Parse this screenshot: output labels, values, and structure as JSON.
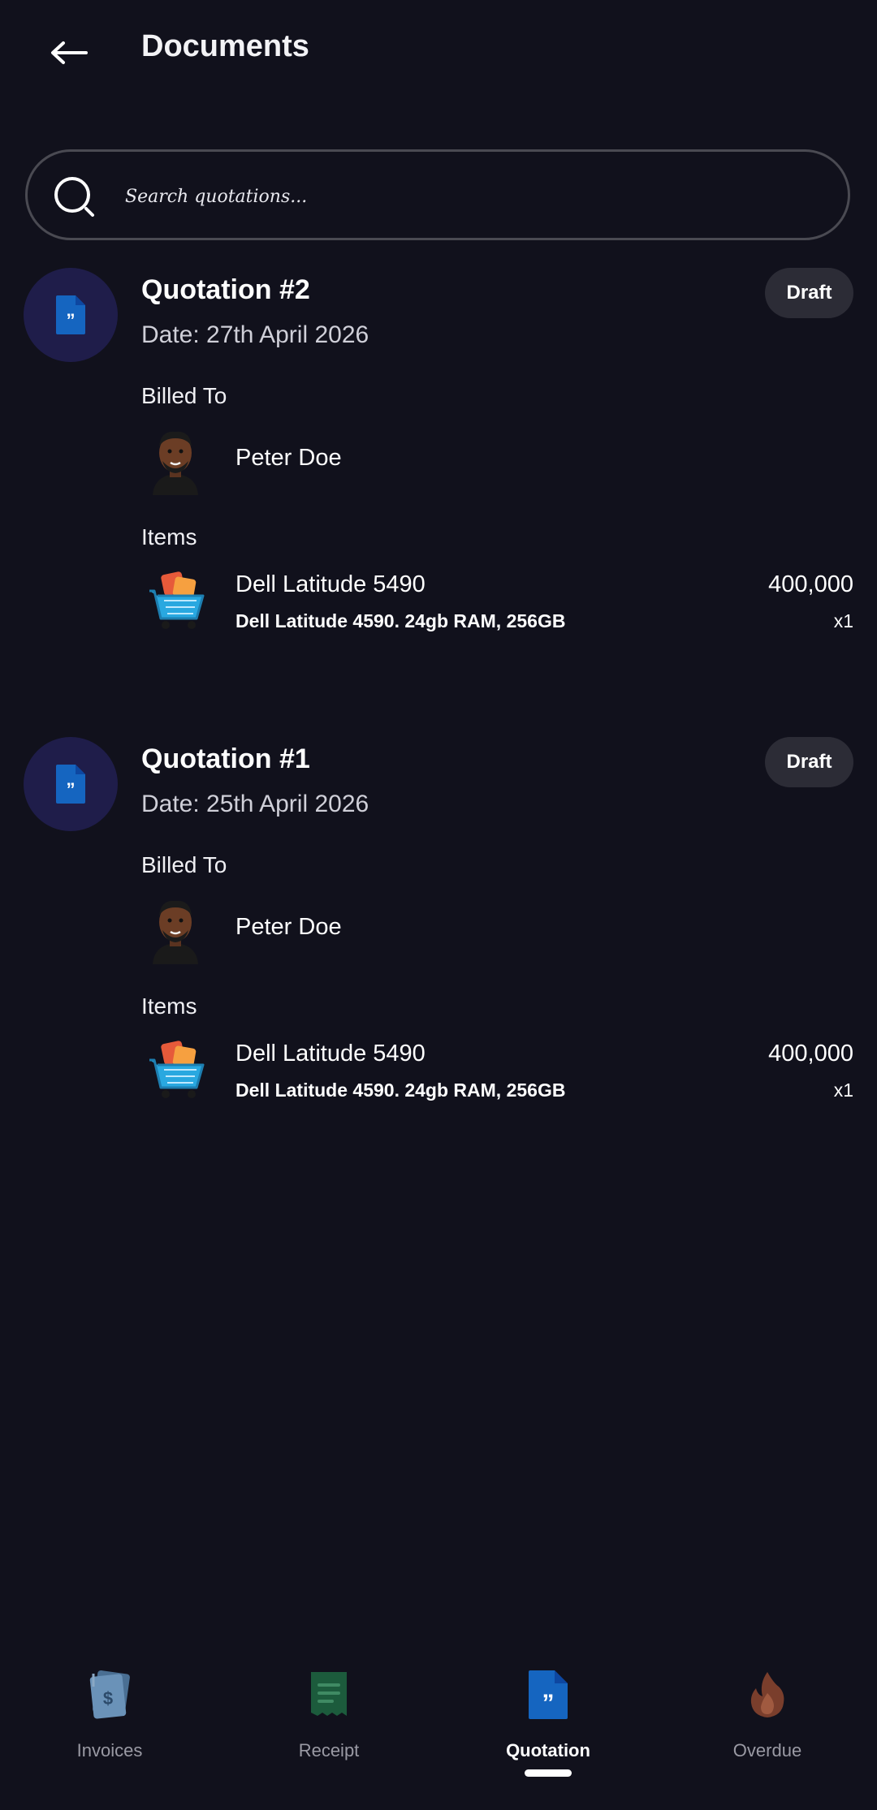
{
  "header": {
    "title": "Documents",
    "back_icon": "arrow-left-icon"
  },
  "search": {
    "placeholder": "Search quotations...",
    "icon": "search-icon"
  },
  "quotations": [
    {
      "title": "Quotation #2",
      "date": "Date: 27th April 2026",
      "status": "Draft",
      "billed_to_label": "Billed To",
      "client_name": "Peter Doe",
      "items_label": "Items",
      "items": [
        {
          "name": "Dell Latitude 5490",
          "description": "Dell Latitude 4590. 24gb RAM, 256GB",
          "price": "400,000",
          "quantity": "x1"
        }
      ]
    },
    {
      "title": "Quotation #1",
      "date": "Date: 25th April 2026",
      "status": "Draft",
      "billed_to_label": "Billed To",
      "client_name": "Peter Doe",
      "items_label": "Items",
      "items": [
        {
          "name": "Dell Latitude 5490",
          "description": "Dell Latitude 4590. 24gb RAM, 256GB",
          "price": "400,000",
          "quantity": "x1"
        }
      ]
    }
  ],
  "bottom_nav": {
    "items": [
      {
        "label": "Invoices",
        "icon": "invoice-icon"
      },
      {
        "label": "Receipt",
        "icon": "receipt-icon"
      },
      {
        "label": "Quotation",
        "icon": "quotation-icon",
        "active": true
      },
      {
        "label": "Overdue",
        "icon": "fire-icon"
      }
    ]
  },
  "colors": {
    "background": "#11111c",
    "badge": "#2c2c36",
    "doc_circle": "#1f1d4a",
    "accent_blue": "#1565c0"
  }
}
